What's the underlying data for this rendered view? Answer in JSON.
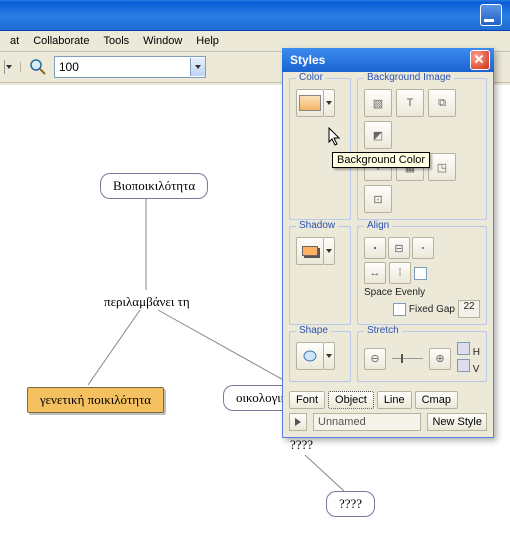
{
  "menu": {
    "items": [
      "at",
      "Collaborate",
      "Tools",
      "Window",
      "Help"
    ]
  },
  "toolbar": {
    "zoom": "100"
  },
  "canvas": {
    "nodes": {
      "n1": "Βιοποικιλότητα",
      "n2": "γενετική ποικιλότητα",
      "n3": "οικολογική ποικιλότητα",
      "n4": "????"
    },
    "links": {
      "l1": "περιλαμβάνει τη",
      "l2": "????"
    }
  },
  "styles": {
    "title": "Styles",
    "groups": {
      "color": "Color",
      "bgimage": "Background Image",
      "shadow": "Shadow",
      "align": "Align",
      "shape": "Shape",
      "stretch": "Stretch"
    },
    "labels": {
      "space": "Space Evenly",
      "fixed": "Fixed Gap",
      "gap": "22",
      "h": "H",
      "v": "V"
    },
    "tooltip": "Background Color",
    "tabs": {
      "font": "Font",
      "object": "Object",
      "line": "Line",
      "cmap": "Cmap"
    },
    "preset": "Unnamed",
    "newstyle": "New Style"
  }
}
